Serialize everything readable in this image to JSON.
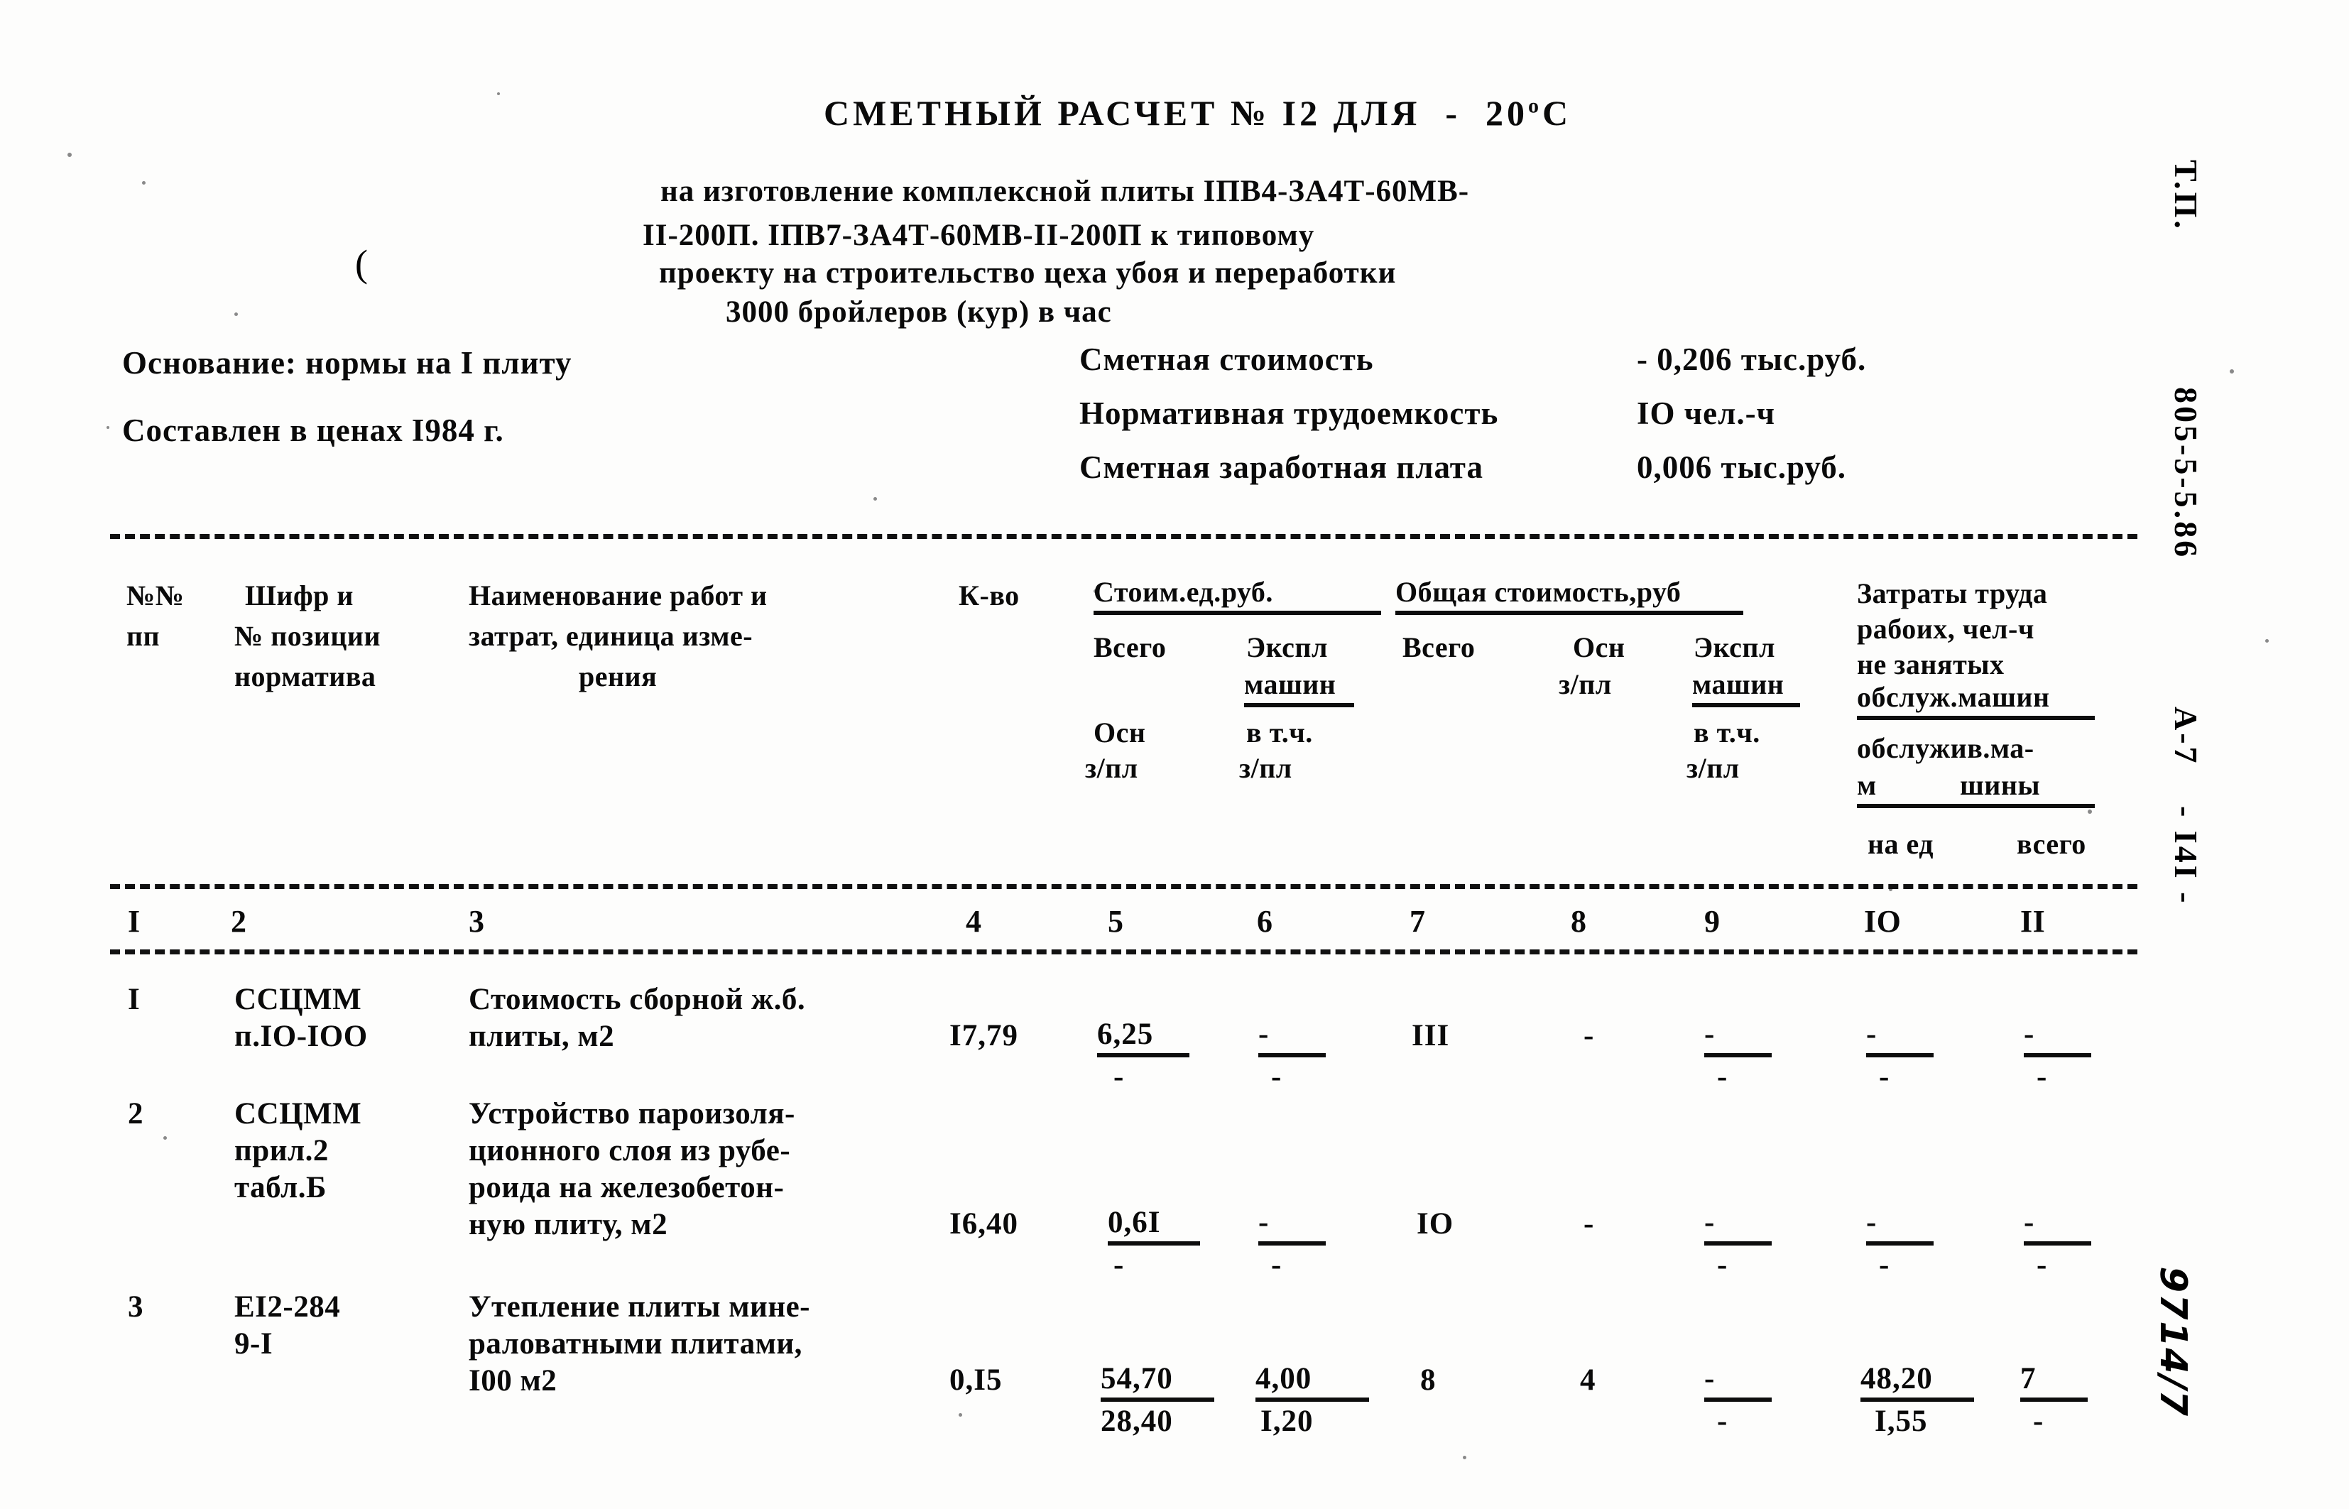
{
  "document": {
    "title_main": "СМЕТНЫЙ РАСЧЕТ № I2 ДЛЯ  -  20",
    "title_sup": "о",
    "title_tail": "С",
    "subtitle_lines": [
      "на изготовление комплексной плиты IПВ4-ЗА4Т-60МВ-",
      "II-200П. IПВ7-ЗА4Т-60МВ-II-200П к типовому",
      "проекту на строительство цеха убоя и переработки",
      "3000 бройлеров (кур) в час"
    ],
    "paren_mark": "("
  },
  "info_left": [
    "Основание: нормы на I плиту",
    "Составлен в ценах I984 г."
  ],
  "info_right": [
    {
      "label": "Сметная стоимость",
      "value": "- 0,206 тыс.руб."
    },
    {
      "label": "Нормативная трудоемкость",
      "value": "IO чел.-ч"
    },
    {
      "label": "Сметная заработная плата",
      "value": "0,006 тыс.руб."
    }
  ],
  "table": {
    "headers": {
      "col1": [
        "№№",
        "пп"
      ],
      "col2": [
        "Шифр и",
        "№ позиции",
        "норматива"
      ],
      "col3": [
        "Наименование работ и",
        "затрат, единица изме-",
        "рения"
      ],
      "col4": "К-во",
      "group_unit_cost": "Стоим.ед.руб.",
      "group_total_cost": "Общая стоимость,руб",
      "col5": "Всего",
      "col6a": "Экспл",
      "col6b": "машин",
      "col7": "Всего",
      "col8a": "Осн",
      "col8b": "з/пл",
      "col9a": "Экспл",
      "col9b": "машин",
      "col5_sub_a": "Осн",
      "col5_sub_b": "з/пл",
      "col6_sub_a": "в т.ч.",
      "col6_sub_b": "з/пл",
      "col9_sub_a": "в т.ч.",
      "col9_sub_b": "з/пл",
      "labour_1": "Затраты труда",
      "labour_2": "рабоих, чел-ч",
      "labour_3": "не занятых",
      "labour_4": "обслуж.машин",
      "labour_5": "обслужив.ма-",
      "labour_6a": "м",
      "labour_6b": "шины",
      "labour_7": "на ед",
      "labour_8": "всего"
    },
    "column_numbers": [
      "I",
      "2",
      "3",
      "4",
      "5",
      "6",
      "7",
      "8",
      "9",
      "IO",
      "II"
    ],
    "rows": [
      {
        "no": "I",
        "code_lines": [
          "ССЦММ",
          "п.IO-IOO"
        ],
        "name_lines": [
          "Стоимость сборной ж.б.",
          "плиты, м2"
        ],
        "qty": "I7,79",
        "unit_total": "6,25",
        "unit_total_sub": "-",
        "unit_mach": "-",
        "unit_mach_sub": "-",
        "tot_all": "III",
        "tot_osn": "-",
        "tot_mach": "-",
        "tot_mach_sub": "-",
        "lab_ed": "-",
        "lab_ed_sub": "-",
        "lab_all": "-",
        "lab_all_sub": "-"
      },
      {
        "no": "2",
        "code_lines": [
          "ССЦММ",
          "прил.2",
          "табл.Б"
        ],
        "name_lines": [
          "Устройство пароизоля-",
          "ционного слоя из рубе-",
          "роида на железобетон-",
          "ную плиту, м2"
        ],
        "qty": "I6,40",
        "unit_total": "0,6I",
        "unit_total_sub": "-",
        "unit_mach": "-",
        "unit_mach_sub": "-",
        "tot_all": "IO",
        "tot_osn": "-",
        "tot_mach": "-",
        "tot_mach_sub": "-",
        "lab_ed": "-",
        "lab_ed_sub": "-",
        "lab_all": "-",
        "lab_all_sub": "-"
      },
      {
        "no": "3",
        "code_lines": [
          "ЕI2-284",
          "9-I"
        ],
        "name_lines": [
          "Утепление плиты мине-",
          "раловатными плитами,",
          "I00 м2"
        ],
        "qty": "0,I5",
        "unit_total": "54,70",
        "unit_total_sub": "28,40",
        "unit_mach": "4,00",
        "unit_mach_sub": "I,20",
        "tot_all": "8",
        "tot_osn": "4",
        "tot_mach": "-",
        "tot_mach_sub": "-",
        "lab_ed": "48,20",
        "lab_ed_sub": "I,55",
        "lab_all": "7",
        "lab_all_sub": "-"
      }
    ]
  },
  "margin": {
    "stamp_tp": "Т.П.",
    "stamp_code": "805-5-5.86",
    "stamp_album": "А-7",
    "stamp_page": "- I4I -",
    "handwritten": "9714/7"
  }
}
